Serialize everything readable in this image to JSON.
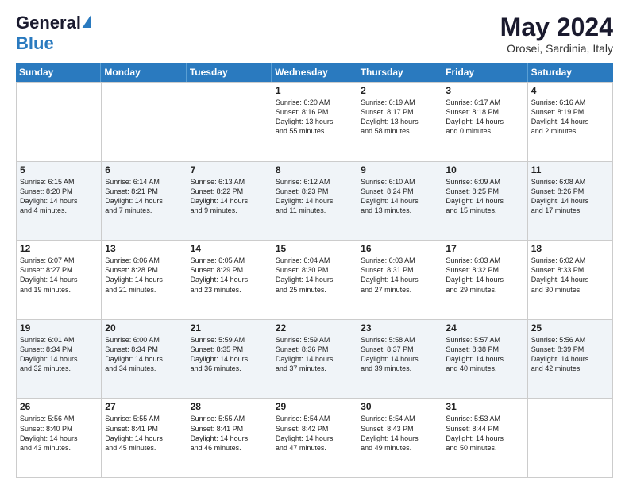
{
  "header": {
    "logo_general": "General",
    "logo_blue": "Blue",
    "month_title": "May 2024",
    "location": "Orosei, Sardinia, Italy"
  },
  "days_of_week": [
    "Sunday",
    "Monday",
    "Tuesday",
    "Wednesday",
    "Thursday",
    "Friday",
    "Saturday"
  ],
  "weeks": [
    [
      {
        "day": "",
        "info": ""
      },
      {
        "day": "",
        "info": ""
      },
      {
        "day": "",
        "info": ""
      },
      {
        "day": "1",
        "info": "Sunrise: 6:20 AM\nSunset: 8:16 PM\nDaylight: 13 hours\nand 55 minutes."
      },
      {
        "day": "2",
        "info": "Sunrise: 6:19 AM\nSunset: 8:17 PM\nDaylight: 13 hours\nand 58 minutes."
      },
      {
        "day": "3",
        "info": "Sunrise: 6:17 AM\nSunset: 8:18 PM\nDaylight: 14 hours\nand 0 minutes."
      },
      {
        "day": "4",
        "info": "Sunrise: 6:16 AM\nSunset: 8:19 PM\nDaylight: 14 hours\nand 2 minutes."
      }
    ],
    [
      {
        "day": "5",
        "info": "Sunrise: 6:15 AM\nSunset: 8:20 PM\nDaylight: 14 hours\nand 4 minutes."
      },
      {
        "day": "6",
        "info": "Sunrise: 6:14 AM\nSunset: 8:21 PM\nDaylight: 14 hours\nand 7 minutes."
      },
      {
        "day": "7",
        "info": "Sunrise: 6:13 AM\nSunset: 8:22 PM\nDaylight: 14 hours\nand 9 minutes."
      },
      {
        "day": "8",
        "info": "Sunrise: 6:12 AM\nSunset: 8:23 PM\nDaylight: 14 hours\nand 11 minutes."
      },
      {
        "day": "9",
        "info": "Sunrise: 6:10 AM\nSunset: 8:24 PM\nDaylight: 14 hours\nand 13 minutes."
      },
      {
        "day": "10",
        "info": "Sunrise: 6:09 AM\nSunset: 8:25 PM\nDaylight: 14 hours\nand 15 minutes."
      },
      {
        "day": "11",
        "info": "Sunrise: 6:08 AM\nSunset: 8:26 PM\nDaylight: 14 hours\nand 17 minutes."
      }
    ],
    [
      {
        "day": "12",
        "info": "Sunrise: 6:07 AM\nSunset: 8:27 PM\nDaylight: 14 hours\nand 19 minutes."
      },
      {
        "day": "13",
        "info": "Sunrise: 6:06 AM\nSunset: 8:28 PM\nDaylight: 14 hours\nand 21 minutes."
      },
      {
        "day": "14",
        "info": "Sunrise: 6:05 AM\nSunset: 8:29 PM\nDaylight: 14 hours\nand 23 minutes."
      },
      {
        "day": "15",
        "info": "Sunrise: 6:04 AM\nSunset: 8:30 PM\nDaylight: 14 hours\nand 25 minutes."
      },
      {
        "day": "16",
        "info": "Sunrise: 6:03 AM\nSunset: 8:31 PM\nDaylight: 14 hours\nand 27 minutes."
      },
      {
        "day": "17",
        "info": "Sunrise: 6:03 AM\nSunset: 8:32 PM\nDaylight: 14 hours\nand 29 minutes."
      },
      {
        "day": "18",
        "info": "Sunrise: 6:02 AM\nSunset: 8:33 PM\nDaylight: 14 hours\nand 30 minutes."
      }
    ],
    [
      {
        "day": "19",
        "info": "Sunrise: 6:01 AM\nSunset: 8:34 PM\nDaylight: 14 hours\nand 32 minutes."
      },
      {
        "day": "20",
        "info": "Sunrise: 6:00 AM\nSunset: 8:34 PM\nDaylight: 14 hours\nand 34 minutes."
      },
      {
        "day": "21",
        "info": "Sunrise: 5:59 AM\nSunset: 8:35 PM\nDaylight: 14 hours\nand 36 minutes."
      },
      {
        "day": "22",
        "info": "Sunrise: 5:59 AM\nSunset: 8:36 PM\nDaylight: 14 hours\nand 37 minutes."
      },
      {
        "day": "23",
        "info": "Sunrise: 5:58 AM\nSunset: 8:37 PM\nDaylight: 14 hours\nand 39 minutes."
      },
      {
        "day": "24",
        "info": "Sunrise: 5:57 AM\nSunset: 8:38 PM\nDaylight: 14 hours\nand 40 minutes."
      },
      {
        "day": "25",
        "info": "Sunrise: 5:56 AM\nSunset: 8:39 PM\nDaylight: 14 hours\nand 42 minutes."
      }
    ],
    [
      {
        "day": "26",
        "info": "Sunrise: 5:56 AM\nSunset: 8:40 PM\nDaylight: 14 hours\nand 43 minutes."
      },
      {
        "day": "27",
        "info": "Sunrise: 5:55 AM\nSunset: 8:41 PM\nDaylight: 14 hours\nand 45 minutes."
      },
      {
        "day": "28",
        "info": "Sunrise: 5:55 AM\nSunset: 8:41 PM\nDaylight: 14 hours\nand 46 minutes."
      },
      {
        "day": "29",
        "info": "Sunrise: 5:54 AM\nSunset: 8:42 PM\nDaylight: 14 hours\nand 47 minutes."
      },
      {
        "day": "30",
        "info": "Sunrise: 5:54 AM\nSunset: 8:43 PM\nDaylight: 14 hours\nand 49 minutes."
      },
      {
        "day": "31",
        "info": "Sunrise: 5:53 AM\nSunset: 8:44 PM\nDaylight: 14 hours\nand 50 minutes."
      },
      {
        "day": "",
        "info": ""
      }
    ]
  ]
}
